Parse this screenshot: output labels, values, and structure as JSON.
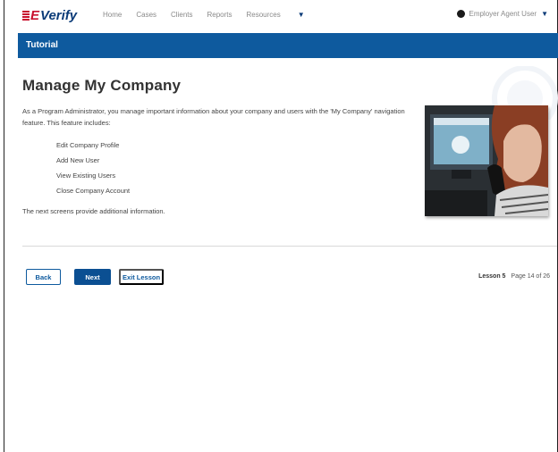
{
  "header": {
    "logo_e": "E",
    "logo_verify": "Verify",
    "nav": [
      {
        "label": "Home"
      },
      {
        "label": "Cases"
      },
      {
        "label": "Clients"
      },
      {
        "label": "Reports"
      },
      {
        "label": "Resources",
        "has_dropdown": true
      }
    ],
    "user_label": "Employer Agent User"
  },
  "tutorial_bar": {
    "title": "Tutorial"
  },
  "content": {
    "title": "Manage My Company",
    "intro": "As a Program Administrator, you manage important information about your company and users with the 'My Company' navigation feature. This feature includes:",
    "features": [
      "Edit Company Profile",
      "Add New User",
      "View Existing Users",
      "Close Company Account"
    ],
    "outro": "The next screens provide additional information."
  },
  "footer": {
    "back_label": "Back",
    "next_label": "Next",
    "exit_label": "Exit Lesson",
    "lesson_label": "Lesson 5",
    "page_label": "Page 14 of 26"
  },
  "colors": {
    "brand_blue": "#0e5a9e",
    "brand_red": "#c8102e",
    "logo_blue": "#0b3b78"
  }
}
